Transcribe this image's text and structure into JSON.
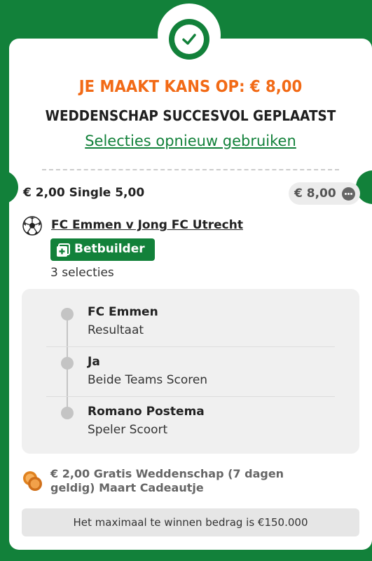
{
  "header": {
    "headline": "JE MAAKT KANS OP: € 8,00",
    "subline": "WEDDENSCHAP SUCCESVOL GEPLAATST",
    "reuse_link": "Selecties opnieuw gebruiken"
  },
  "bet": {
    "stake_line": "€ 2,00 Single 5,00",
    "potential_return": "€ 8,00",
    "event_title": "FC Emmen v Jong FC Utrecht",
    "badge_label": "Betbuilder",
    "selection_count": "3 selecties",
    "selections": [
      {
        "name": "FC Emmen",
        "market": "Resultaat"
      },
      {
        "name": "Ja",
        "market": "Beide Teams Scoren"
      },
      {
        "name": "Romano Postema",
        "market": "Speler Scoort"
      }
    ],
    "free_bet_text": "€ 2,00 Gratis Weddenschap (7 dagen geldig) Maart Cadeautje",
    "max_payout_text": "Het maximaal te winnen bedrag is €150.000"
  },
  "colors": {
    "brand_green": "#12813a",
    "accent_orange": "#f26a16"
  },
  "icons": [
    "check-icon",
    "soccer-ball-icon",
    "betbuilder-plus-icon",
    "more-dots-icon",
    "coins-icon"
  ]
}
